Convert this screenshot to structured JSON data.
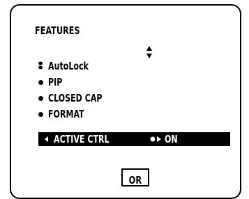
{
  "menu": {
    "title": "FEATURES",
    "items": [
      {
        "label": "AutoLock",
        "icon": "selected-bullet-icon"
      },
      {
        "label": "PIP",
        "icon": "bullet-icon"
      },
      {
        "label": "CLOSED CAP",
        "icon": "bullet-icon"
      },
      {
        "label": "FORMAT",
        "icon": "bullet-icon"
      }
    ],
    "active_row": {
      "label": "ACTIVE CTRL",
      "value": "ON",
      "left_icon": "left-arrow-icon",
      "toggle_icon": "toggle-icon"
    },
    "nav_icon": "up-down-arrows-icon"
  },
  "bottom_button": {
    "label": "OR"
  }
}
